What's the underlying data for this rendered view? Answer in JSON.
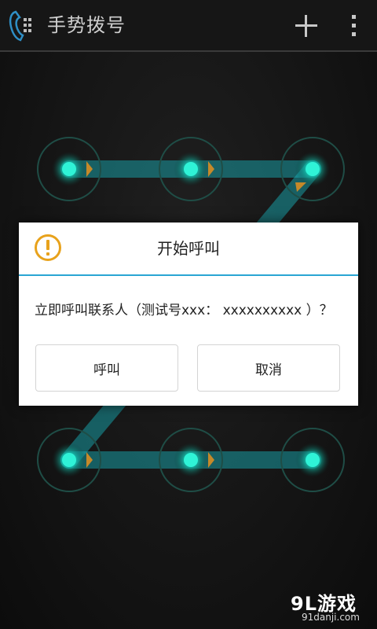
{
  "action_bar": {
    "title": "手势拨号",
    "icons": {
      "app": "phone-keypad-icon",
      "add": "plus-icon",
      "menu": "overflow-menu-icon"
    }
  },
  "pattern": {
    "dot_count": 9,
    "colors": {
      "glow": "#1be0c2",
      "line": "#19c2c8",
      "ring": "#1f4d46",
      "arrow": "#c5892a"
    }
  },
  "dialog": {
    "title": "开始呼叫",
    "message": "立即呼叫联系人（测试号xxx： xxxxxxxxxx ）？",
    "call_label": "呼叫",
    "cancel_label": "取消",
    "icon": "warning-icon",
    "accent": "#2aa5d3",
    "warning_color": "#e8a21c"
  },
  "watermark": {
    "logo": "9L游戏",
    "url": "91danji.com"
  }
}
